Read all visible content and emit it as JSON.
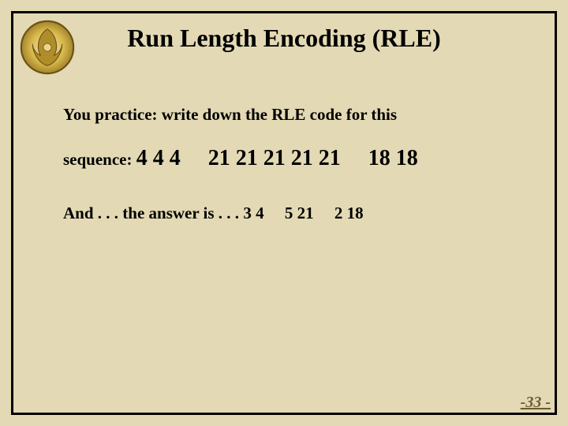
{
  "title": "Run Length Encoding (RLE)",
  "line1": "You practice: write down the RLE code for this",
  "sequence_label": "sequence: ",
  "sequence_numbers": "4 4 4  21 21 21 21 21  18 18",
  "answer_prefix": "And . . . the answer is . . . ",
  "answer_values": "3 4  5  21  2 18",
  "page_number": "-33 -"
}
